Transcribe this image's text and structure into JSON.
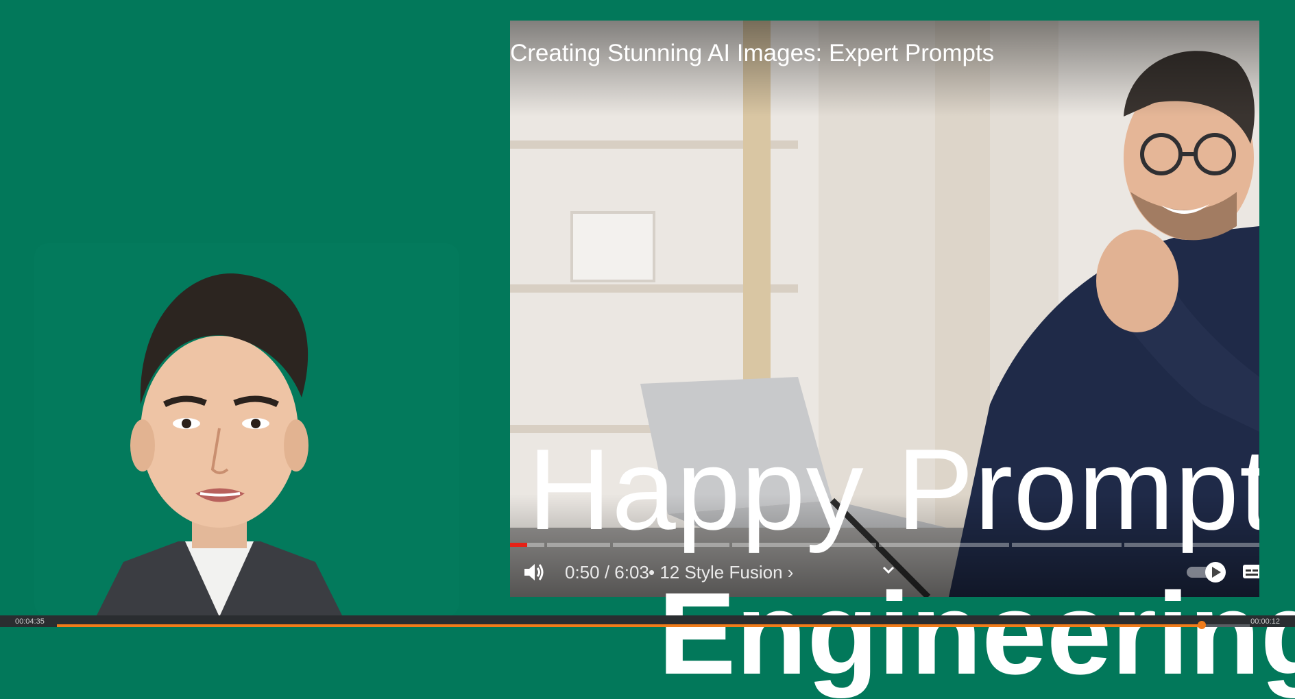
{
  "video": {
    "title": "Creating Stunning AI Images: Expert Prompts",
    "overlay_text": "Happy Prompt",
    "current_time": "0:50",
    "separator": " / ",
    "duration": "6:03",
    "chapter": "• 12 Style Fusion ›",
    "progress_fraction": 0.023,
    "icons": [
      "volume-icon",
      "chevron-down-icon",
      "autoplay-toggle-icon",
      "captions-icon"
    ]
  },
  "background": {
    "word": "Engineering"
  },
  "recorder": {
    "elapsed": "00:04:35",
    "remaining": "00:00:12",
    "progress_fraction": 0.96
  },
  "colors": {
    "background_green": "#02785a",
    "progress_red": "#e62117",
    "recorder_orange": "#f07c1a"
  }
}
